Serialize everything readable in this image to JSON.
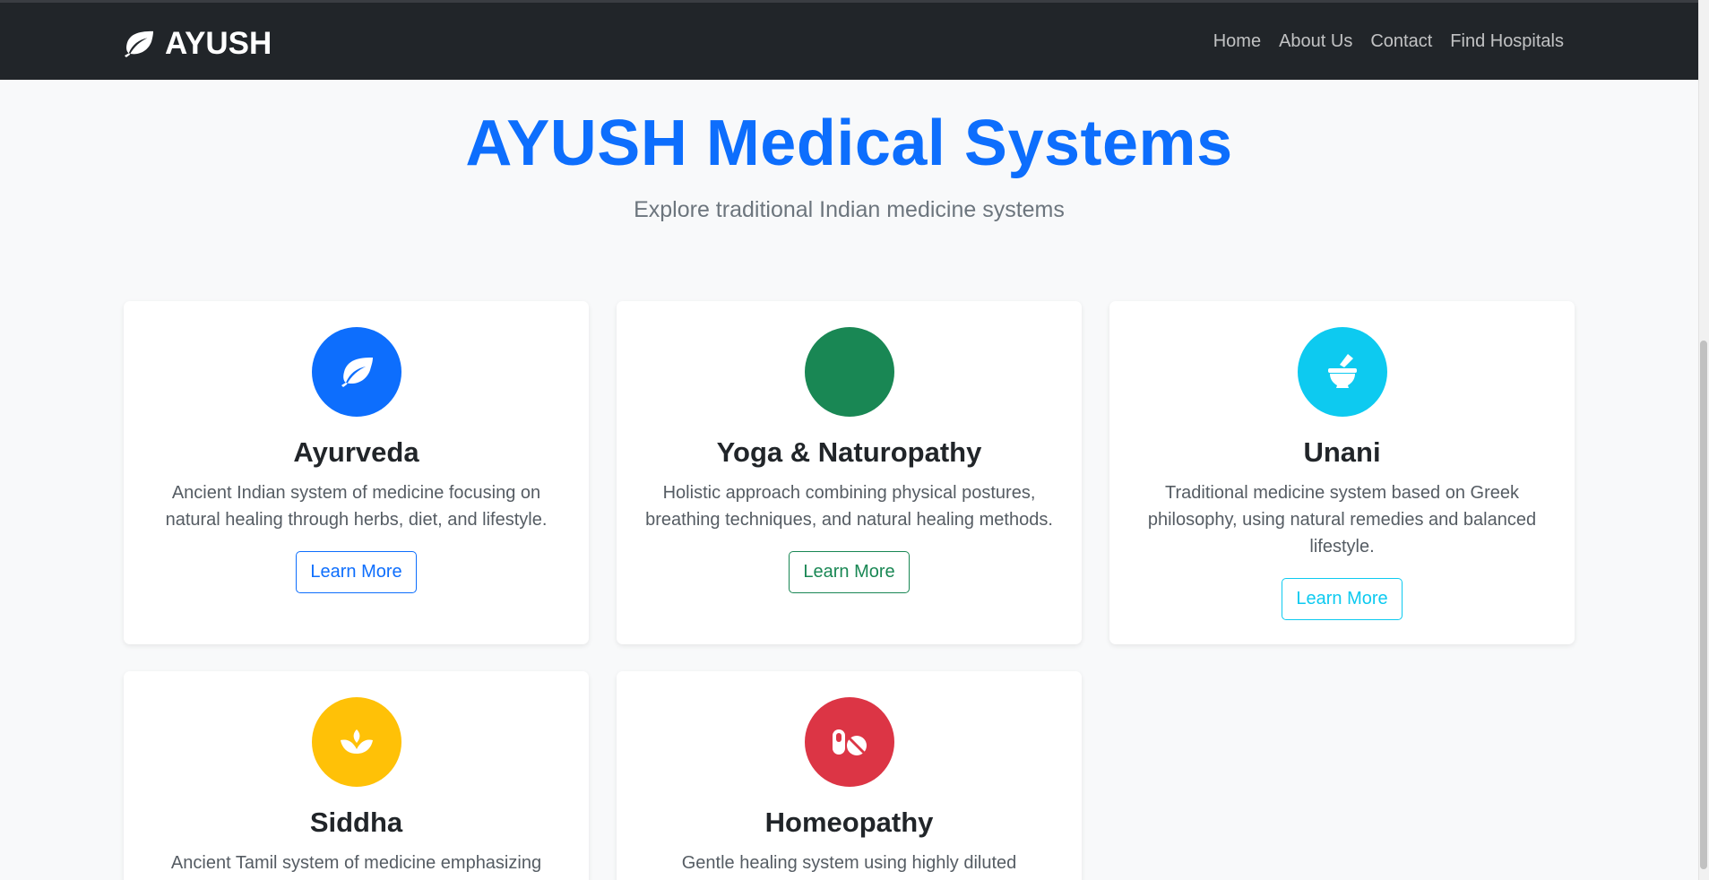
{
  "navbar": {
    "brand": "AYUSH",
    "links": [
      "Home",
      "About Us",
      "Contact",
      "Find Hospitals"
    ]
  },
  "hero": {
    "title": "AYUSH Medical Systems",
    "subtitle": "Explore traditional Indian medicine systems"
  },
  "cards": [
    {
      "title": "Ayurveda",
      "text": "Ancient Indian system of medicine focusing on natural healing through herbs, diet, and lifestyle.",
      "button": "Learn More",
      "icon": "leaf-icon",
      "color": "#0d6efd"
    },
    {
      "title": "Yoga & Naturopathy",
      "text": "Holistic approach combining physical postures, breathing techniques, and natural healing methods.",
      "button": "Learn More",
      "icon": "yoga-icon",
      "color": "#198754"
    },
    {
      "title": "Unani",
      "text": "Traditional medicine system based on Greek philosophy, using natural remedies and balanced lifestyle.",
      "button": "Learn More",
      "icon": "mortar-pestle-icon",
      "color": "#0dcaf0"
    },
    {
      "title": "Siddha",
      "text": "Ancient Tamil system of medicine emphasizing",
      "icon": "lotus-icon",
      "color": "#ffc107"
    },
    {
      "title": "Homeopathy",
      "text": "Gentle healing system using highly diluted",
      "icon": "pills-icon",
      "color": "#dc3545"
    }
  ]
}
